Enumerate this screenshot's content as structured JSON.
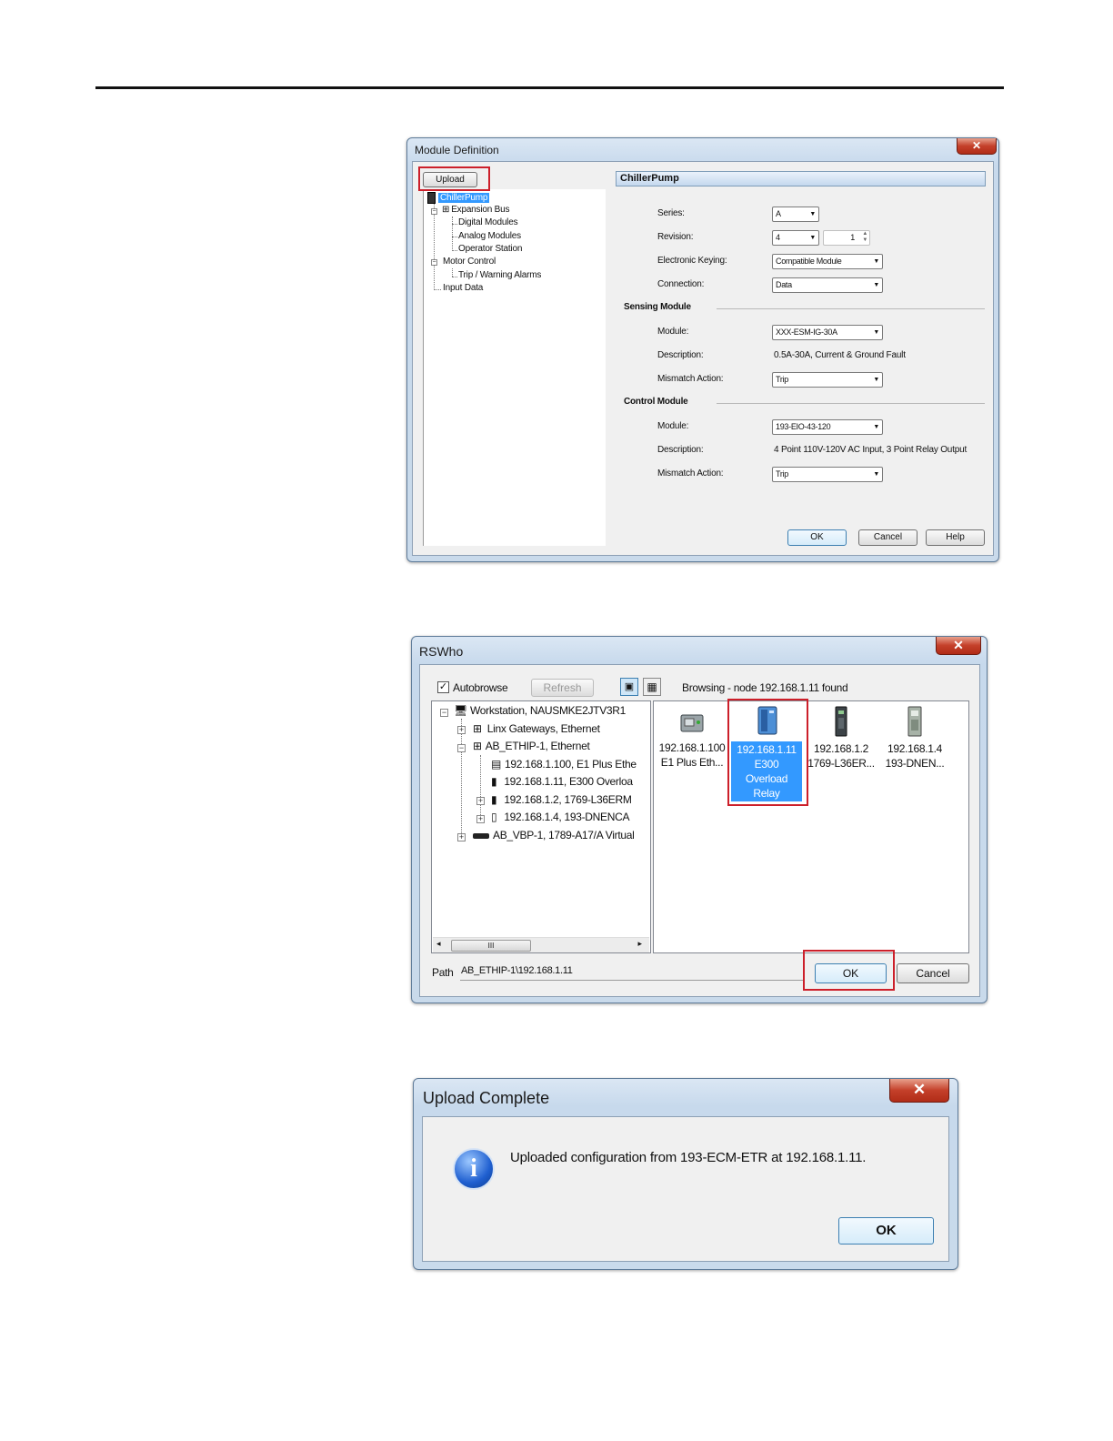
{
  "module_definition": {
    "title": "Module Definition",
    "close_glyph": "✕",
    "upload_label": "Upload",
    "tree": {
      "root": "ChillerPump",
      "expansion_bus": "Expansion Bus",
      "digital_modules": "Digital Modules",
      "analog_modules": "Analog Modules",
      "operator_station": "Operator Station",
      "motor_control": "Motor Control",
      "trip_warning": "Trip / Warning Alarms",
      "input_data": "Input Data"
    },
    "header": "ChillerPump",
    "series_label": "Series:",
    "series_value": "A",
    "revision_label": "Revision:",
    "revision_major": "4",
    "revision_minor": "1",
    "keying_label": "Electronic Keying:",
    "keying_value": "Compatible Module",
    "connection_label": "Connection:",
    "connection_value": "Data",
    "sensing_title": "Sensing Module",
    "sensing_module_label": "Module:",
    "sensing_module_value": "XXX-ESM-IG-30A",
    "sensing_desc_label": "Description:",
    "sensing_desc_value": "0.5A-30A, Current & Ground Fault",
    "sensing_mismatch_label": "Mismatch Action:",
    "sensing_mismatch_value": "Trip",
    "control_title": "Control Module",
    "control_module_label": "Module:",
    "control_module_value": "193-EIO-43-120",
    "control_desc_label": "Description:",
    "control_desc_value": "4 Point 110V-120V AC Input, 3 Point Relay Output",
    "control_mismatch_label": "Mismatch Action:",
    "control_mismatch_value": "Trip",
    "ok_label": "OK",
    "cancel_label": "Cancel",
    "help_label": "Help"
  },
  "rswho": {
    "title": "RSWho",
    "close_glyph": "✕",
    "autobrowse_label": "Autobrowse",
    "autobrowse_checked": true,
    "refresh_label": "Refresh",
    "status": "Browsing - node 192.168.1.11 found",
    "tree": {
      "workstation": "Workstation, NAUSMKE2JTV3R1",
      "linx": "Linx Gateways, Ethernet",
      "ab_ethip": "AB_ETHIP-1, Ethernet",
      "node_100": "192.168.1.100, E1 Plus Ethe",
      "node_11": "192.168.1.11, E300 Overloa",
      "node_2": "192.168.1.2, 1769-L36ERM",
      "node_4": "192.168.1.4, 193-DNENCA",
      "ab_vbp": "AB_VBP-1, 1789-A17/A Virtual"
    },
    "devices": [
      {
        "line1": "192.168.1.100",
        "line2": "E1 Plus Eth..."
      },
      {
        "line1": "192.168.1.11",
        "line2": "E300",
        "line3": "Overload",
        "line4": "Relay"
      },
      {
        "line1": "192.168.1.2",
        "line2": "1769-L36ER..."
      },
      {
        "line1": "192.168.1.4",
        "line2": "193-DNEN..."
      }
    ],
    "scroll_thumb_glyph": "III",
    "path_label": "Path",
    "path_value": "AB_ETHIP-1\\192.168.1.11",
    "ok_label": "OK",
    "cancel_label": "Cancel"
  },
  "upload_complete": {
    "title": "Upload Complete",
    "close_glyph": "✕",
    "message": "Uploaded configuration from 193-ECM-ETR at 192.168.1.11.",
    "ok_label": "OK",
    "info_glyph": "i"
  },
  "colors": {
    "selection": "#3399ff",
    "callout_red": "#cc1f2a",
    "title_close": "#c4402a"
  }
}
